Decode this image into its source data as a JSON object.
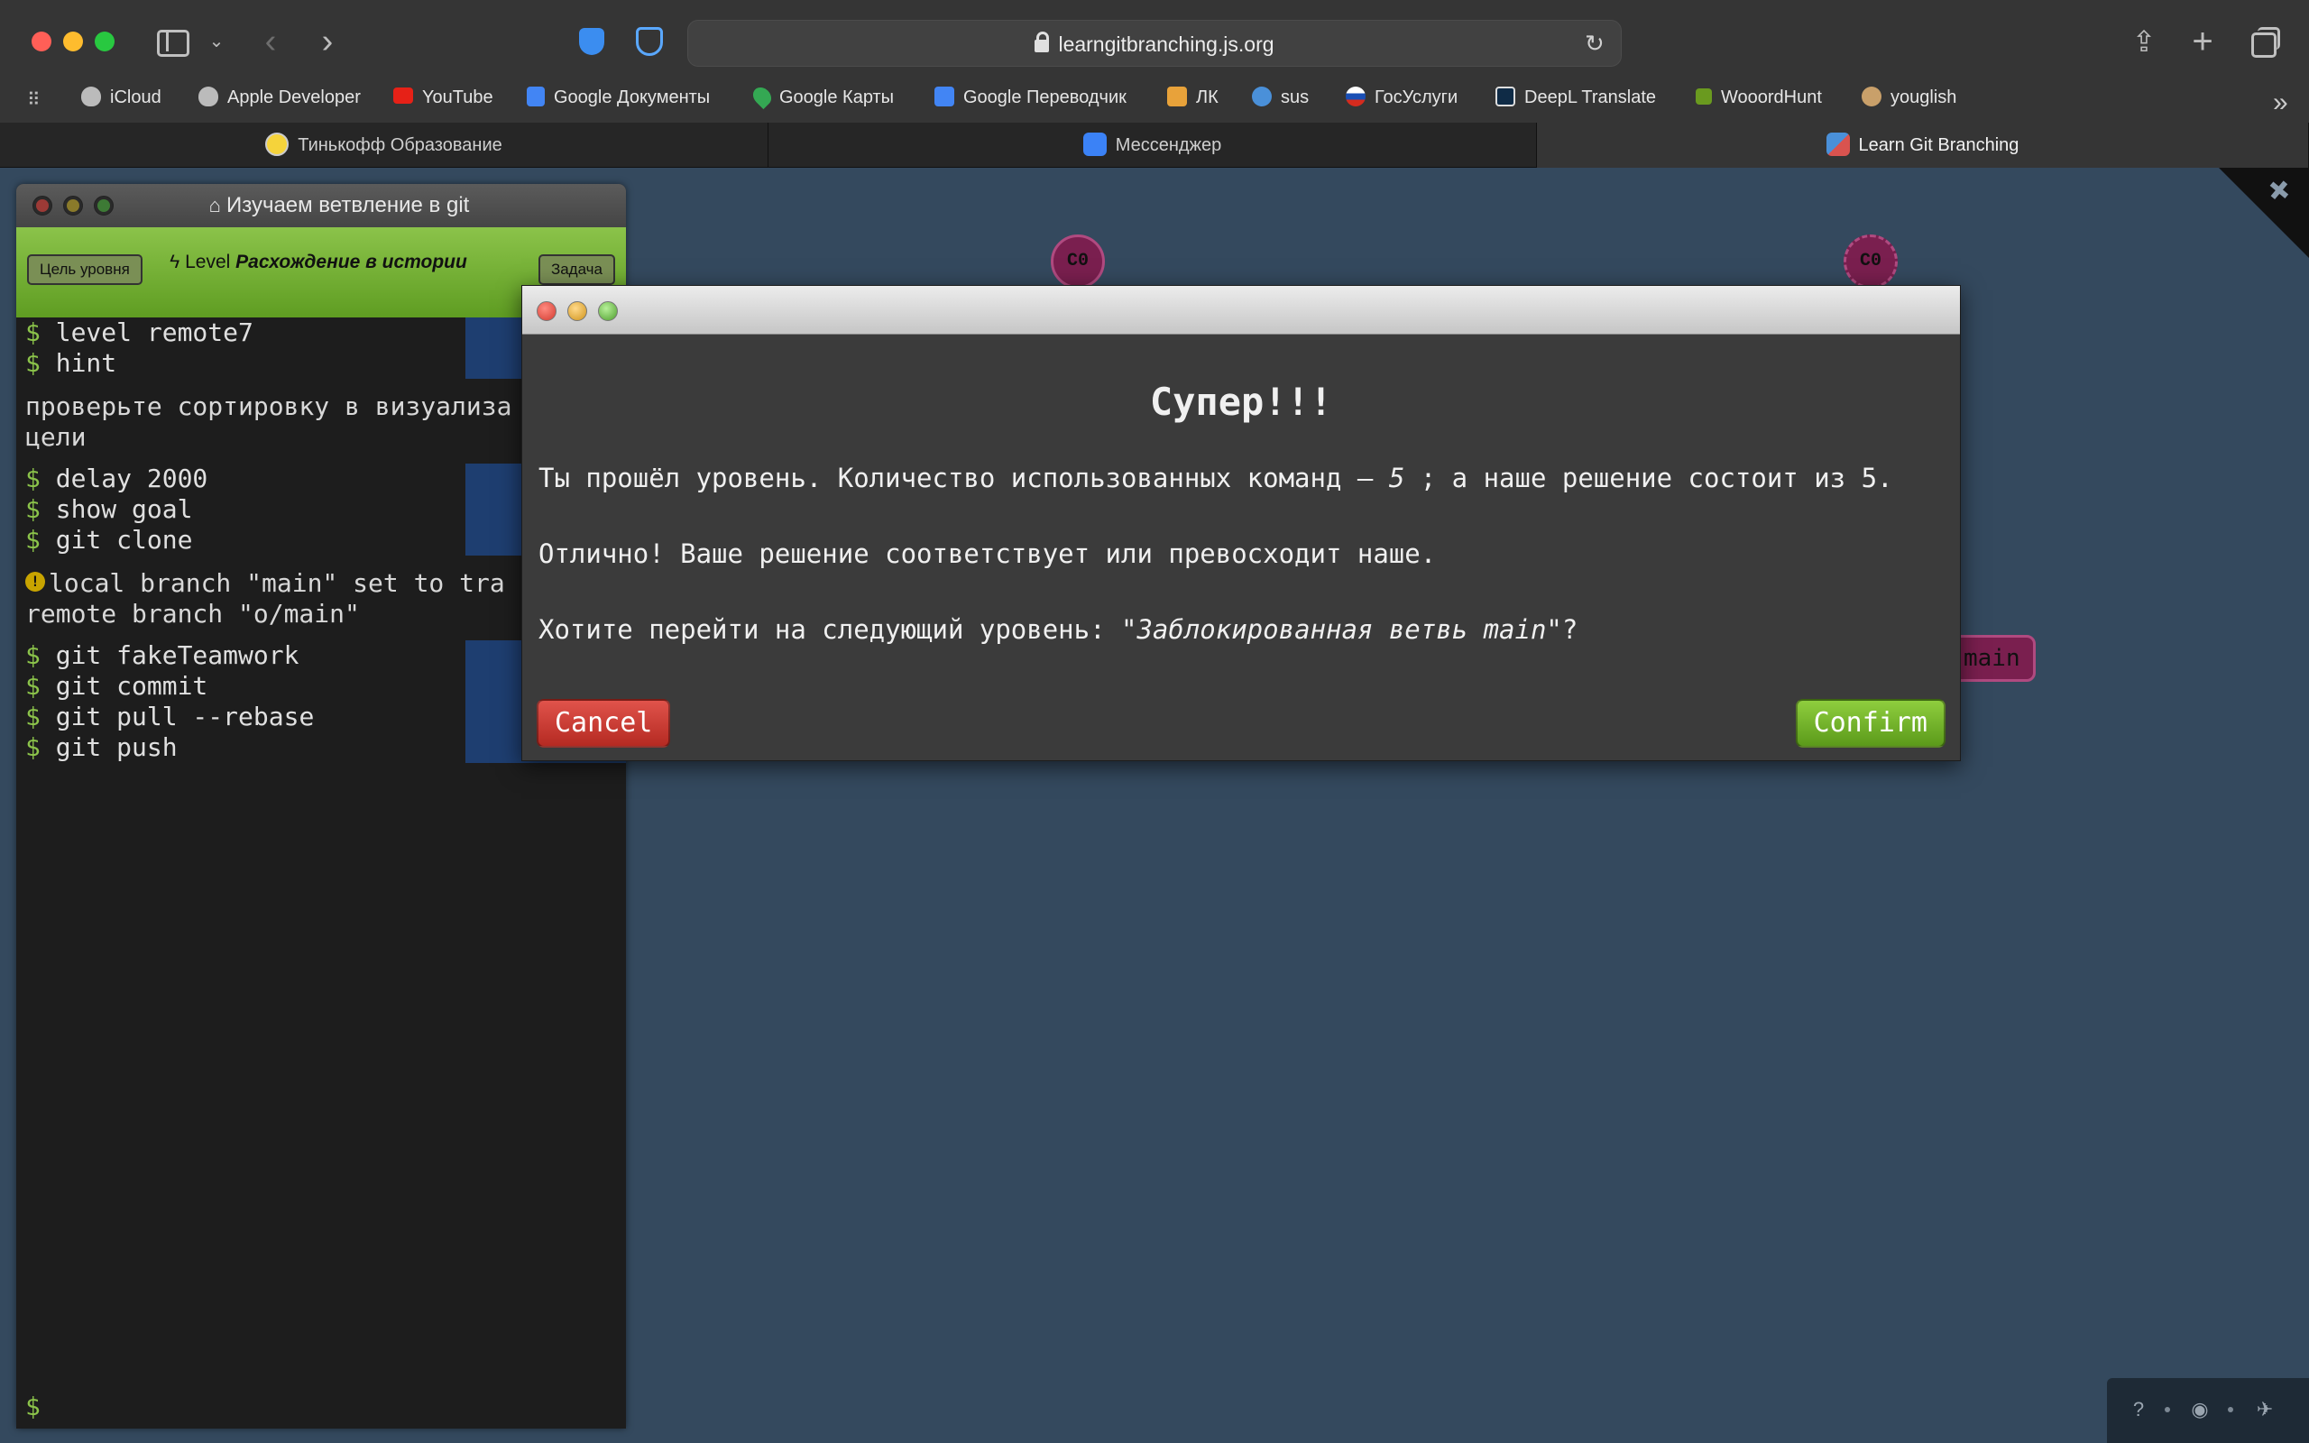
{
  "browser": {
    "url": "learngitbranching.js.org",
    "bookmarks": [
      {
        "label": "iCloud",
        "icon": "apple-icon",
        "color": "#bbbbbb"
      },
      {
        "label": "Apple Developer",
        "icon": "apple-icon",
        "color": "#bbbbbb"
      },
      {
        "label": "YouTube",
        "icon": "youtube-icon",
        "color": "#ff0000"
      },
      {
        "label": "Google Документы",
        "icon": "google-docs-icon",
        "color": "#4285f4"
      },
      {
        "label": "Google Карты",
        "icon": "google-maps-icon",
        "color": "#34a853"
      },
      {
        "label": "Google Переводчик",
        "icon": "google-translate-icon",
        "color": "#4285f4"
      },
      {
        "label": "ЛК",
        "icon": "lk-icon",
        "color": "#e8a23a"
      },
      {
        "label": "sus",
        "icon": "yandex-icon",
        "color": "#4a90d9"
      },
      {
        "label": "ГосУслуги",
        "icon": "gosuslugi-icon",
        "color": "#d52b1e"
      },
      {
        "label": "DeepL Translate",
        "icon": "deepl-icon",
        "color": "#0f2b46"
      },
      {
        "label": "WooordHunt",
        "icon": "wooordhunt-icon",
        "color": "#6a9a1f"
      },
      {
        "label": "youglish",
        "icon": "youglish-icon",
        "color": "#c9a06a"
      }
    ],
    "tabs": [
      {
        "label": "Тинькофф Образование",
        "icon": "tinkoff-icon",
        "color": "#f5d33b"
      },
      {
        "label": "Мессенджер",
        "icon": "messenger-icon",
        "color": "#3b82f6"
      },
      {
        "label": "Learn Git Branching",
        "icon": "git-branching-icon",
        "color": "#4a90d9"
      }
    ]
  },
  "terminal": {
    "title": "Изучаем ветвление в git",
    "goal_button": "Цель уровня",
    "task_button": "Задача",
    "level_prefix": "Level",
    "level_name": "Расхождение в истории",
    "prompt": "$",
    "commands_1": [
      "level remote7",
      "hint"
    ],
    "output_1": [
      "проверьте сортировку в визуализа",
      "цели"
    ],
    "commands_2": [
      "delay 2000",
      "show goal",
      "git clone"
    ],
    "output_2": [
      "local branch \"main\" set to tra",
      "remote branch \"o/main\""
    ],
    "commands_3": [
      "git fakeTeamwork",
      "git commit",
      "git pull --rebase",
      "git push"
    ]
  },
  "graph": {
    "commit_left": "C0",
    "commit_right": "C0",
    "branch_label": "main",
    "commit_color": "#7a1f4f"
  },
  "dialog": {
    "heading": "Супер!!!",
    "line1_before": "Ты прошёл уровень. Количество использованных команд – ",
    "line1_count": "5",
    "line1_after": " ; а наше решение состоит из 5.",
    "line2": "Отлично! Ваше решение соответствует или превосходит наше.",
    "line3_before": "Хотите перейти на следующий уровень: \"",
    "line3_level": "Заблокированная ветвь main",
    "line3_after": "\"?",
    "cancel": "Cancel",
    "confirm": "Confirm"
  }
}
